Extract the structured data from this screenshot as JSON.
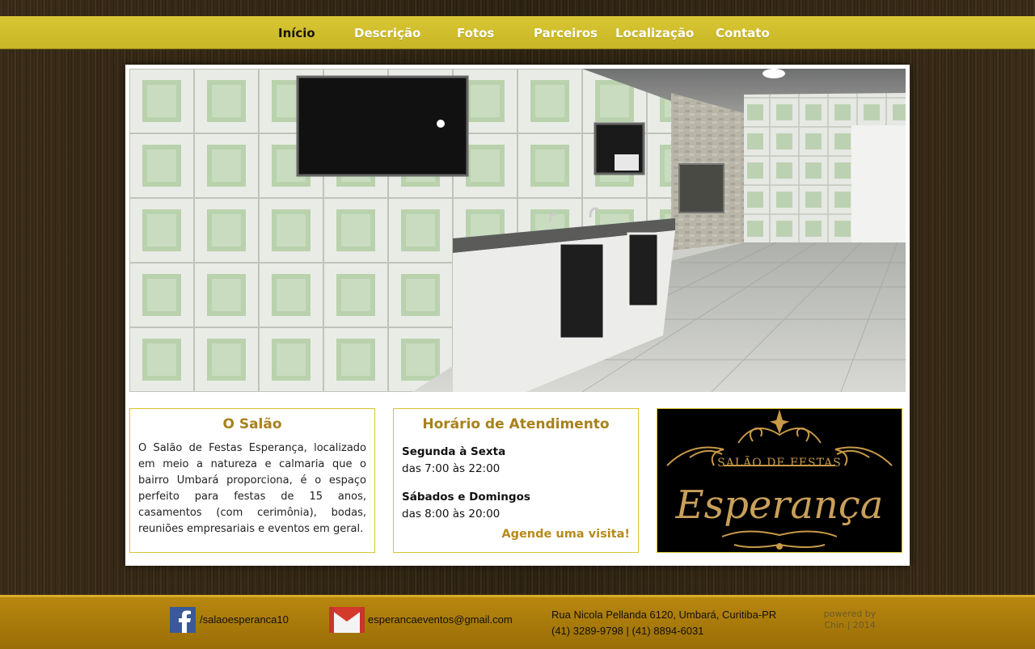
{
  "nav": {
    "items": [
      {
        "label": "Início",
        "active": true
      },
      {
        "label": "Descrição"
      },
      {
        "label": "Fotos"
      },
      {
        "label": "Parceiros"
      },
      {
        "label": "Localização"
      },
      {
        "label": "Contato"
      }
    ]
  },
  "salao": {
    "title": "O Salão",
    "text": "O Salão de Festas Esperança, localizado em meio a natureza e calmaria que o bairro Umbará proporciona, é o espaço perfeito para festas de 15 anos, casamentos (com cerimônia), bodas, reuniões empresariais e eventos em geral."
  },
  "horario": {
    "title": "Horário de Atendimento",
    "schedule": [
      {
        "days": "Segunda à Sexta",
        "time": "das 7:00 às 22:00"
      },
      {
        "days": "Sábados e Domingos",
        "time": "das 8:00 às 20:00"
      }
    ],
    "cta": "Agende uma visita!"
  },
  "logo": {
    "line1": "SALÃO DE FESTAS",
    "line2": "Esperança"
  },
  "footer": {
    "facebook": "/salaoesperanca10",
    "email": "esperancaeventos@gmail.com",
    "address": "Rua Nicola Pellanda 6120, Umbará, Curitiba-PR",
    "phones": "(41) 3289-9798 | (41) 8894-6031",
    "powered_by": "powered by",
    "credit": "Chin | 2014"
  },
  "colors": {
    "accent": "#d4c22f",
    "gold": "#a8811a",
    "footer": "#b8870f"
  }
}
